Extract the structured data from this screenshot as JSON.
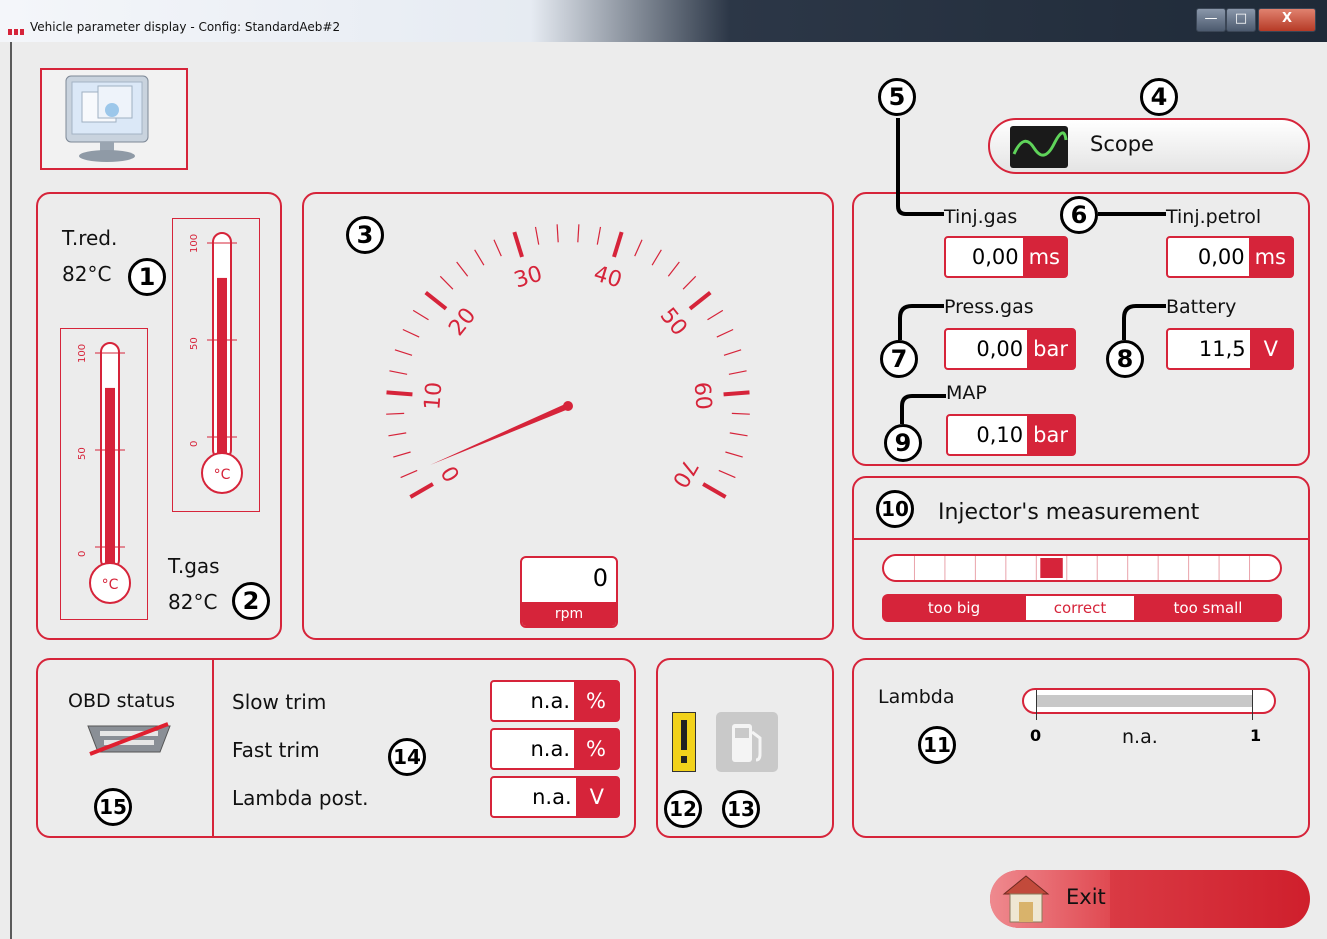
{
  "window": {
    "title": "Vehicle parameter display - Config: StandardAeb#2",
    "minimize": "—",
    "maximize": "□",
    "close": "X"
  },
  "scope_button": {
    "label": "Scope"
  },
  "temperatures": {
    "t_red_label": "T.red.",
    "t_red_value": "82°C",
    "t_gas_label": "T.gas",
    "t_gas_value": "82°C",
    "unit_c": "°C",
    "ticks": [
      "100",
      "50",
      "0"
    ],
    "t_red_level": 82,
    "t_gas_level": 82
  },
  "rpm_gauge": {
    "scale": [
      "0",
      "10",
      "20",
      "30",
      "40",
      "50",
      "60",
      "70"
    ],
    "value": "0",
    "unit": "rpm",
    "needle_value": 2
  },
  "params": {
    "tinj_gas": {
      "label": "Tinj.gas",
      "value": "0,00",
      "unit": "ms"
    },
    "tinj_petrol": {
      "label": "Tinj.petrol",
      "value": "0,00",
      "unit": "ms"
    },
    "press_gas": {
      "label": "Press.gas",
      "value": "0,00",
      "unit": "bar"
    },
    "battery": {
      "label": "Battery",
      "value": "11,5",
      "unit": "V"
    },
    "map": {
      "label": "MAP",
      "value": "0,10",
      "unit": "bar"
    }
  },
  "injector": {
    "title": "Injector's measurement",
    "segments": 13,
    "active_segment": 5,
    "too_big": "too big",
    "correct": "correct",
    "too_small": "too small"
  },
  "obd": {
    "status_label": "OBD status",
    "rows": [
      {
        "label": "Slow trim",
        "value": "n.a.",
        "unit": "%"
      },
      {
        "label": "Fast trim",
        "value": "n.a.",
        "unit": "%"
      },
      {
        "label": "Lambda post.",
        "value": "n.a.",
        "unit": "V"
      }
    ]
  },
  "lambda": {
    "label": "Lambda",
    "min": "0",
    "max": "1",
    "value": "n.a."
  },
  "exit_button": {
    "label": "Exit"
  },
  "callouts": [
    "1",
    "2",
    "3",
    "4",
    "5",
    "6",
    "7",
    "8",
    "9",
    "10",
    "11",
    "12",
    "13",
    "14",
    "15"
  ],
  "colors": {
    "accent": "#d6243a",
    "warning": "#f2d21b"
  }
}
